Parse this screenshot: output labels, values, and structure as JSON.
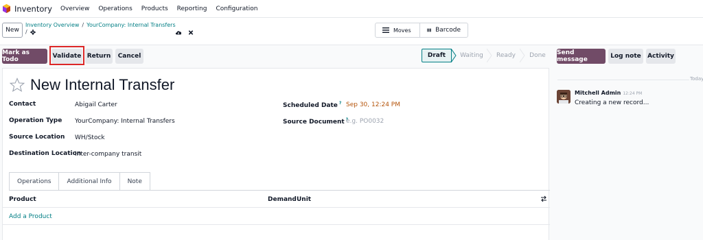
{
  "navbar": {
    "app_name": "Inventory",
    "menu": [
      "Overview",
      "Operations",
      "Products",
      "Reporting",
      "Configuration"
    ]
  },
  "control": {
    "new_label": "New",
    "breadcrumb": {
      "parent": "Inventory Overview",
      "separator": "/",
      "current": "YourCompany: Internal Transfers",
      "line2_sep": "/"
    },
    "moves_label": "Moves",
    "barcode_label": "Barcode"
  },
  "actions": {
    "mark_todo": "Mark as Todo",
    "validate": "Validate",
    "return": "Return",
    "cancel": "Cancel"
  },
  "status": {
    "stages": [
      "Draft",
      "Waiting",
      "Ready",
      "Done"
    ],
    "active": "Draft"
  },
  "form": {
    "title": "New Internal Transfer",
    "contact_label": "Contact",
    "contact_value": "Abigail Carter",
    "operation_type_label": "Operation Type",
    "operation_type_value": "YourCompany: Internal Transfers",
    "source_location_label": "Source Location",
    "source_location_value": "WH/Stock",
    "destination_location_label": "Destination Location",
    "destination_location_value": "Inter-company transit",
    "scheduled_date_label": "Scheduled Date",
    "scheduled_date_value": "Sep 30, 12:24 PM",
    "source_document_label": "Source Document",
    "source_document_placeholder": "e.g. PO0032",
    "help_mark": "?"
  },
  "tabs": [
    "Operations",
    "Additional Info",
    "Note"
  ],
  "table": {
    "columns": [
      "Product",
      "Demand",
      "Unit"
    ],
    "add_line": "Add a Product"
  },
  "chatter": {
    "send_message": "Send message",
    "log_note": "Log note",
    "activity": "Activity",
    "date_divider": "Today",
    "message": {
      "author": "Mitchell Admin",
      "time": "12:24 PM",
      "body": "Creating a new record..."
    }
  },
  "colors": {
    "brand": "#714b67",
    "accent": "#017e84",
    "highlight": "#dc2626",
    "date": "#b45309"
  }
}
